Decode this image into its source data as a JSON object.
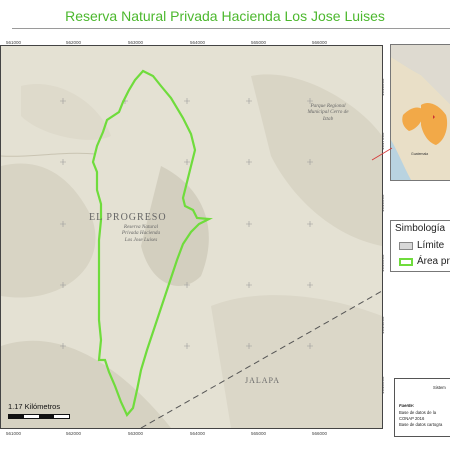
{
  "title": "Reserva Natural Privada Hacienda Los Jose Luises",
  "map": {
    "labels": {
      "town": "EL PROGRESO",
      "reserve": "Reserva Natural Privada Hacienda Los Jose Luises",
      "park": "Parque Regional Municipal Cerro de Iztab",
      "dept": "JALAPA"
    },
    "ticks_x": [
      "561000",
      "562000",
      "563000",
      "564000",
      "565000",
      "566000"
    ],
    "ticks_y": [
      "1646000",
      "1647000",
      "1646000",
      "1645000",
      "1644000",
      "1643000"
    ],
    "colors": {
      "boundary": "#6fdc3c",
      "terrain": "#e6e3d6",
      "dash": "#555555"
    }
  },
  "scale": {
    "label": "1.17 Kilómetros"
  },
  "legend": {
    "title": "Simbología",
    "items": [
      {
        "label": "Límite",
        "swatch": "#d8d8d8",
        "border": "#888888"
      },
      {
        "label": "Área pr",
        "swatch": "#ffffff",
        "border": "#6fdc3c"
      }
    ]
  },
  "info": {
    "heading": "Sistem",
    "fuente": "Fuente:",
    "line1": "Base de datos de la",
    "line2": "CONAP 2016",
    "line3": "Base de datos cartogra"
  },
  "inset": {
    "label": "Guatemala"
  }
}
